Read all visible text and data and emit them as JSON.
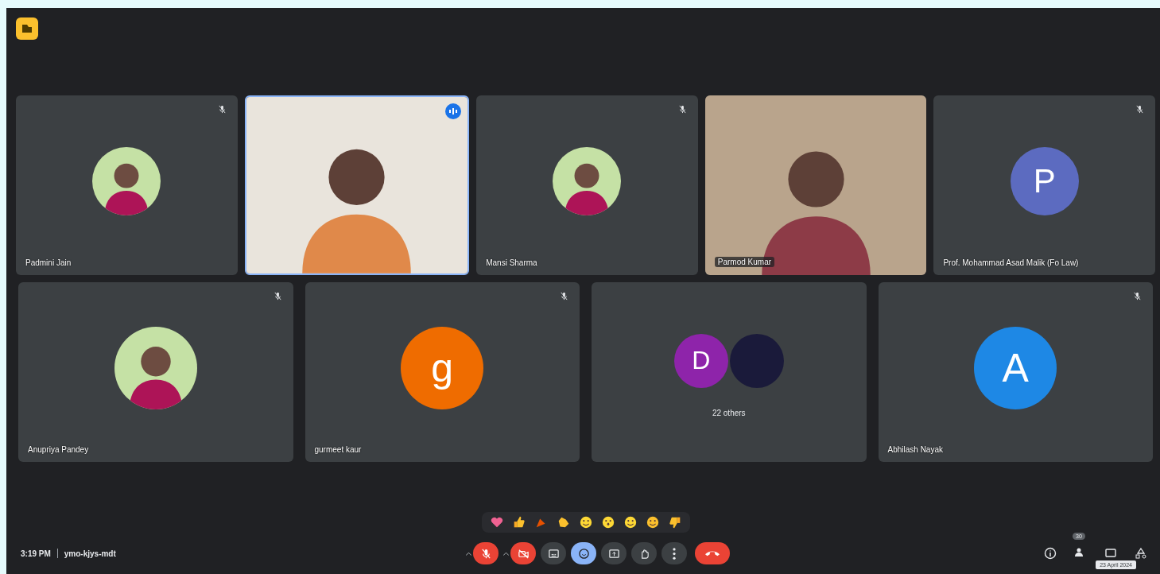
{
  "meeting": {
    "time": "3:19 PM",
    "code": "ymo-kjys-mdt"
  },
  "rows": [
    {
      "tiles": [
        {
          "kind": "photo",
          "name": "Padmini Jain",
          "muted": true,
          "speaking": false
        },
        {
          "kind": "video",
          "muted": false,
          "speaking": true
        },
        {
          "kind": "photo",
          "name": "Mansi Sharma",
          "muted": true,
          "speaking": false
        },
        {
          "kind": "video",
          "name": "Parmod Kumar",
          "muted": false,
          "speaking": false
        },
        {
          "kind": "initial",
          "name": "Prof. Mohammad Asad Malik (Fo Law)",
          "initial": "P",
          "color": "#5c6bc0",
          "muted": true,
          "speaking": false
        }
      ]
    },
    {
      "tiles": [
        {
          "kind": "photo",
          "name": "Anupriya Pandey",
          "muted": true,
          "speaking": false
        },
        {
          "kind": "initial",
          "name": "gurmeet kaur",
          "initial": "g",
          "color": "#ef6c00",
          "muted": true,
          "speaking": false
        },
        {
          "kind": "group",
          "initial": "D",
          "color": "#8e24aa",
          "others": "22 others",
          "muted": false,
          "speaking": false
        },
        {
          "kind": "initial",
          "name": "Abhilash Nayak",
          "initial": "A",
          "color": "#1e88e5",
          "muted": true,
          "speaking": false
        }
      ]
    }
  ],
  "reactions": [
    {
      "kind": "heart"
    },
    {
      "kind": "thumbs-up"
    },
    {
      "kind": "party"
    },
    {
      "kind": "clap"
    },
    {
      "kind": "laugh"
    },
    {
      "kind": "surprised"
    },
    {
      "kind": "smile"
    },
    {
      "kind": "thinking"
    },
    {
      "kind": "thumbs-down"
    }
  ],
  "controls": [
    {
      "kind": "mic",
      "on": false
    },
    {
      "kind": "camera",
      "on": false
    },
    {
      "kind": "captions",
      "on": false
    },
    {
      "kind": "reactions",
      "on": true
    },
    {
      "kind": "present",
      "on": false
    },
    {
      "kind": "hand",
      "on": false
    },
    {
      "kind": "more",
      "on": false
    },
    {
      "kind": "end"
    }
  ],
  "side": {
    "badge": "30",
    "tooltip": "23 April 2024"
  }
}
